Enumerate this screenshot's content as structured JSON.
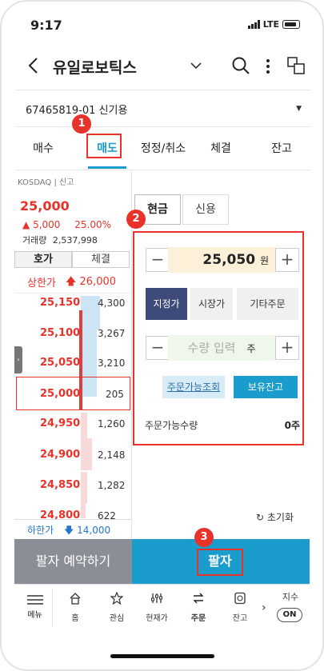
{
  "status_bar": {
    "time": "9:17",
    "network": "LTE"
  },
  "header": {
    "title": "유일로보틱스"
  },
  "account": {
    "label": "67465819-01 신기용"
  },
  "tabs": [
    {
      "label": "매수"
    },
    {
      "label": "매도"
    },
    {
      "label": "정정/취소"
    },
    {
      "label": "체결"
    },
    {
      "label": "잔고"
    }
  ],
  "annotations": {
    "step1": "1",
    "step2": "2",
    "step3": "3"
  },
  "stock": {
    "exchange": "KOSDAQ | 신고",
    "price": "25,000",
    "change": "5,000",
    "change_pct": "25.00%",
    "volume_label": "거래량",
    "volume": "2,537,998"
  },
  "book_tabs": {
    "quote": "호가",
    "trade": "체결"
  },
  "limits": {
    "upper_label": "상한가",
    "upper_value": "26,000",
    "lower_label": "하한가",
    "lower_value": "14,000"
  },
  "order_book": {
    "asks": [
      {
        "price": "25,150",
        "qty": "4,300"
      },
      {
        "price": "25,100",
        "qty": "3,267"
      },
      {
        "price": "25,050",
        "qty": "3,210"
      },
      {
        "price": "25,000",
        "qty": "205"
      }
    ],
    "bids": [
      {
        "price": "24,950",
        "qty": "1,260"
      },
      {
        "price": "24,900",
        "qty": "2,148"
      },
      {
        "price": "24,850",
        "qty": "1,282"
      },
      {
        "price": "24,800",
        "qty": "622"
      }
    ]
  },
  "order_form": {
    "cash_label": "현금",
    "credit_label": "신용",
    "price_value": "25,050",
    "price_unit": "원",
    "order_types": [
      "지정가",
      "시장가",
      "기타주문"
    ],
    "qty_placeholder": "수량 입력",
    "qty_unit": "주",
    "available_lookup": "주문가능조회",
    "holdings": "보유잔고",
    "available_label": "주문가능수량",
    "available_value": "0주",
    "reset": "초기화"
  },
  "actions": {
    "reserve": "팔자 예약하기",
    "sell": "팔자"
  },
  "nav": {
    "menu": "메뉴",
    "items": [
      "홈",
      "관심",
      "현재가",
      "주문",
      "잔고"
    ],
    "index_label": "지수",
    "index_toggle": "ON"
  },
  "colors": {
    "accent": "#1a9ccc",
    "up": "#e8322a",
    "down": "#2277cc",
    "annotation": "#e8322a"
  }
}
